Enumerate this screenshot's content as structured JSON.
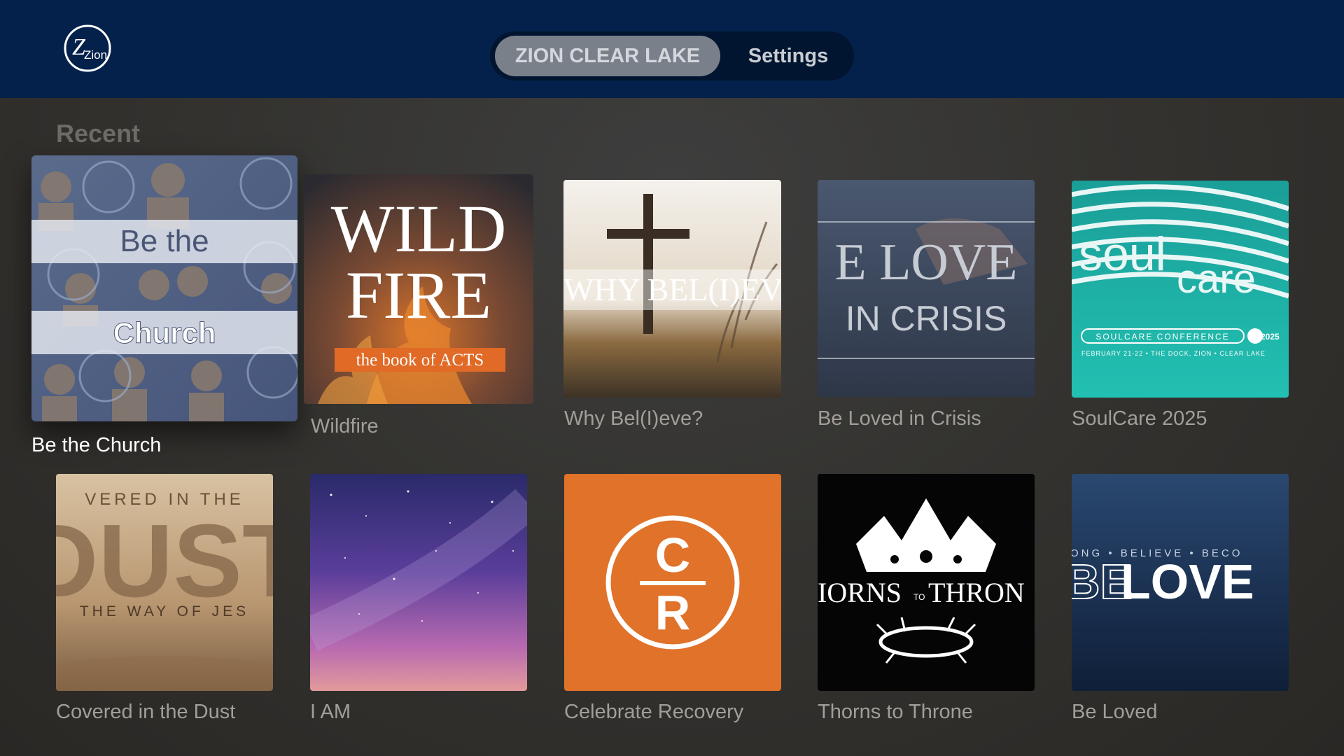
{
  "header": {
    "logo_text": "Zion",
    "tabs": [
      {
        "label": "ZION CLEAR LAKE",
        "selected": true
      },
      {
        "label": "Settings",
        "selected": false
      }
    ]
  },
  "section": {
    "title": "Recent"
  },
  "tiles": [
    {
      "title": "Be the Church",
      "focused": true,
      "art_text": [
        "Be the",
        "Church"
      ]
    },
    {
      "title": "Wildfire",
      "art_text": [
        "WILD",
        "FIRE",
        "the book of ACTS"
      ]
    },
    {
      "title": "Why Bel(I)eve?",
      "art_text": [
        "WHY BEL(I)EV"
      ]
    },
    {
      "title": "Be Loved in Crisis",
      "art_text": [
        "E LOVE",
        "IN CRISIS"
      ]
    },
    {
      "title": "SoulCare 2025",
      "art_text": [
        "soul",
        "care",
        "SOULCARE CONFERENCE",
        "2025",
        "FEBRUARY 21-22  •  THE DOCK, ZION • CLEAR LAKE"
      ]
    },
    {
      "title": "Covered in the Dust",
      "art_text": [
        "VERED IN THE",
        "DUST",
        "THE WAY OF JES"
      ]
    },
    {
      "title": "I AM",
      "art_text": []
    },
    {
      "title": "Celebrate Recovery",
      "art_text": [
        "C",
        "R"
      ]
    },
    {
      "title": "Thorns to Throne",
      "art_text": [
        "IORNS",
        "TO",
        "THRON"
      ]
    },
    {
      "title": "Be Loved",
      "art_text": [
        "ONG • BELIEVE • BECO",
        "BE",
        "LOVE"
      ]
    }
  ],
  "colors": {
    "header_bg": "#03214a",
    "segment_selected": "#7a808a",
    "label_dim": "#a29e98",
    "label_focused": "#ffffff",
    "recovery_orange": "#e0722a",
    "soulcare_teal": "#1fb5a9"
  }
}
